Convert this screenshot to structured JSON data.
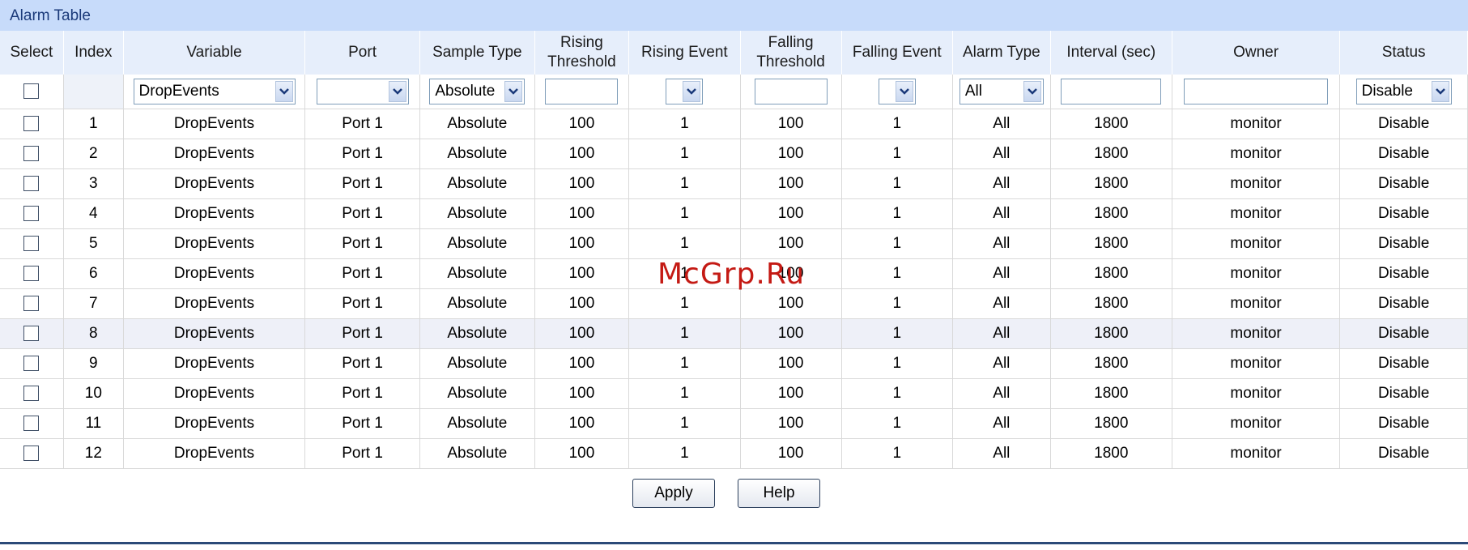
{
  "panel": {
    "title": "Alarm Table"
  },
  "columns": [
    "Select",
    "Index",
    "Variable",
    "Port",
    "Sample Type",
    "Rising Threshold",
    "Rising Event",
    "Falling Threshold",
    "Falling Event",
    "Alarm Type",
    "Interval (sec)",
    "Owner",
    "Status"
  ],
  "columns_lines": {
    "rising_threshold": [
      "Rising",
      "Threshold"
    ],
    "falling_threshold": [
      "Falling",
      "Threshold"
    ]
  },
  "filter": {
    "variable": "DropEvents",
    "port": "",
    "sample_type": "Absolute",
    "rising_threshold": "",
    "rising_event": "",
    "falling_threshold": "",
    "falling_event": "",
    "alarm_type": "All",
    "interval": "",
    "owner": "",
    "status": "Disable"
  },
  "rows": [
    {
      "index": "1",
      "variable": "DropEvents",
      "port": "Port 1",
      "sample_type": "Absolute",
      "rising_threshold": "100",
      "rising_event": "1",
      "falling_threshold": "100",
      "falling_event": "1",
      "alarm_type": "All",
      "interval": "1800",
      "owner": "monitor",
      "status": "Disable"
    },
    {
      "index": "2",
      "variable": "DropEvents",
      "port": "Port 1",
      "sample_type": "Absolute",
      "rising_threshold": "100",
      "rising_event": "1",
      "falling_threshold": "100",
      "falling_event": "1",
      "alarm_type": "All",
      "interval": "1800",
      "owner": "monitor",
      "status": "Disable"
    },
    {
      "index": "3",
      "variable": "DropEvents",
      "port": "Port 1",
      "sample_type": "Absolute",
      "rising_threshold": "100",
      "rising_event": "1",
      "falling_threshold": "100",
      "falling_event": "1",
      "alarm_type": "All",
      "interval": "1800",
      "owner": "monitor",
      "status": "Disable"
    },
    {
      "index": "4",
      "variable": "DropEvents",
      "port": "Port 1",
      "sample_type": "Absolute",
      "rising_threshold": "100",
      "rising_event": "1",
      "falling_threshold": "100",
      "falling_event": "1",
      "alarm_type": "All",
      "interval": "1800",
      "owner": "monitor",
      "status": "Disable"
    },
    {
      "index": "5",
      "variable": "DropEvents",
      "port": "Port 1",
      "sample_type": "Absolute",
      "rising_threshold": "100",
      "rising_event": "1",
      "falling_threshold": "100",
      "falling_event": "1",
      "alarm_type": "All",
      "interval": "1800",
      "owner": "monitor",
      "status": "Disable"
    },
    {
      "index": "6",
      "variable": "DropEvents",
      "port": "Port 1",
      "sample_type": "Absolute",
      "rising_threshold": "100",
      "rising_event": "1",
      "falling_threshold": "100",
      "falling_event": "1",
      "alarm_type": "All",
      "interval": "1800",
      "owner": "monitor",
      "status": "Disable"
    },
    {
      "index": "7",
      "variable": "DropEvents",
      "port": "Port 1",
      "sample_type": "Absolute",
      "rising_threshold": "100",
      "rising_event": "1",
      "falling_threshold": "100",
      "falling_event": "1",
      "alarm_type": "All",
      "interval": "1800",
      "owner": "monitor",
      "status": "Disable"
    },
    {
      "index": "8",
      "variable": "DropEvents",
      "port": "Port 1",
      "sample_type": "Absolute",
      "rising_threshold": "100",
      "rising_event": "1",
      "falling_threshold": "100",
      "falling_event": "1",
      "alarm_type": "All",
      "interval": "1800",
      "owner": "monitor",
      "status": "Disable"
    },
    {
      "index": "9",
      "variable": "DropEvents",
      "port": "Port 1",
      "sample_type": "Absolute",
      "rising_threshold": "100",
      "rising_event": "1",
      "falling_threshold": "100",
      "falling_event": "1",
      "alarm_type": "All",
      "interval": "1800",
      "owner": "monitor",
      "status": "Disable"
    },
    {
      "index": "10",
      "variable": "DropEvents",
      "port": "Port 1",
      "sample_type": "Absolute",
      "rising_threshold": "100",
      "rising_event": "1",
      "falling_threshold": "100",
      "falling_event": "1",
      "alarm_type": "All",
      "interval": "1800",
      "owner": "monitor",
      "status": "Disable"
    },
    {
      "index": "11",
      "variable": "DropEvents",
      "port": "Port 1",
      "sample_type": "Absolute",
      "rising_threshold": "100",
      "rising_event": "1",
      "falling_threshold": "100",
      "falling_event": "1",
      "alarm_type": "All",
      "interval": "1800",
      "owner": "monitor",
      "status": "Disable"
    },
    {
      "index": "12",
      "variable": "DropEvents",
      "port": "Port 1",
      "sample_type": "Absolute",
      "rising_threshold": "100",
      "rising_event": "1",
      "falling_threshold": "100",
      "falling_event": "1",
      "alarm_type": "All",
      "interval": "1800",
      "owner": "monitor",
      "status": "Disable"
    }
  ],
  "highlighted_row_index": "8",
  "buttons": {
    "apply": "Apply",
    "help": "Help"
  },
  "watermark": "McGrp.Ru",
  "icons": {
    "dropdown": "chevron-down-icon",
    "checkbox": "checkbox-icon"
  },
  "colors": {
    "title_bar": "#c7dbfa",
    "header_bg": "#e6eefb",
    "accent": "#2b4a78",
    "watermark": "#c41a14"
  }
}
